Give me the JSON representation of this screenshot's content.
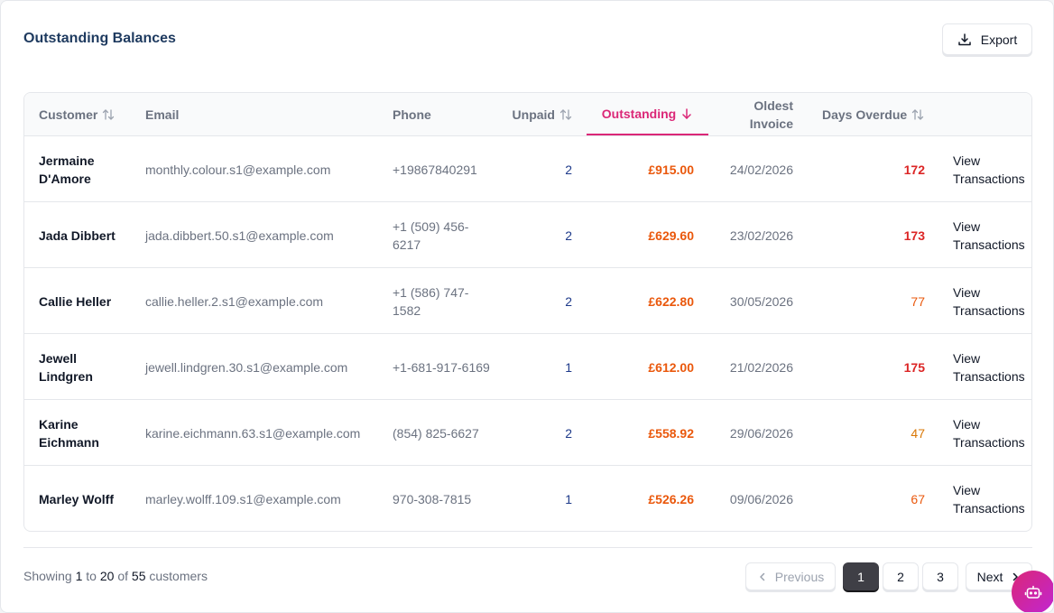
{
  "page": {
    "title": "Outstanding Balances",
    "export_label": "Export"
  },
  "columns": {
    "customer": "Customer",
    "email": "Email",
    "phone": "Phone",
    "unpaid": "Unpaid",
    "outstanding": "Outstanding",
    "oldest_line1": "Oldest",
    "oldest_line2": "Invoice",
    "days_overdue": "Days Overdue"
  },
  "rows": [
    {
      "customer": "Jermaine D'Amore",
      "email": "monthly.colour.s1@example.com",
      "phone": "+19867840291",
      "unpaid": "2",
      "outstanding": "£915.00",
      "oldest": "24/02/2026",
      "days": "172",
      "days_color": "#dc2626",
      "action": "View Transactions"
    },
    {
      "customer": "Jada Dibbert",
      "email": "jada.dibbert.50.s1@example.com",
      "phone": "+1 (509) 456-6217",
      "unpaid": "2",
      "outstanding": "£629.60",
      "oldest": "23/02/2026",
      "days": "173",
      "days_color": "#dc2626",
      "action": "View Transactions"
    },
    {
      "customer": "Callie Heller",
      "email": "callie.heller.2.s1@example.com",
      "phone": "+1 (586) 747-1582",
      "unpaid": "2",
      "outstanding": "£622.80",
      "oldest": "30/05/2026",
      "days": "77",
      "days_color": "#ea580c",
      "action": "View Transactions"
    },
    {
      "customer": "Jewell Lindgren",
      "email": "jewell.lindgren.30.s1@example.com",
      "phone": "+1-681-917-6169",
      "unpaid": "1",
      "outstanding": "£612.00",
      "oldest": "21/02/2026",
      "days": "175",
      "days_color": "#dc2626",
      "action": "View Transactions"
    },
    {
      "customer": "Karine Eichmann",
      "email": "karine.eichmann.63.s1@example.com",
      "phone": "(854) 825-6627",
      "unpaid": "2",
      "outstanding": "£558.92",
      "oldest": "29/06/2026",
      "days": "47",
      "days_color": "#d97706",
      "action": "View Transactions"
    },
    {
      "customer": "Marley Wolff",
      "email": "marley.wolff.109.s1@example.com",
      "phone": "970-308-7815",
      "unpaid": "1",
      "outstanding": "£526.26",
      "oldest": "09/06/2026",
      "days": "67",
      "days_color": "#ea580c",
      "action": "View Transactions"
    }
  ],
  "footer": {
    "showing_prefix": "Showing",
    "from": "1",
    "to_word": "to",
    "to": "20",
    "of_word": "of",
    "total": "55",
    "suffix": "customers",
    "previous": "Previous",
    "next": "Next",
    "pages": [
      "1",
      "2",
      "3"
    ],
    "current_page": "1"
  },
  "icons": {
    "export": "download-icon",
    "sort": "sort-arrows-icon",
    "sort_active": "arrow-down-icon",
    "prev": "chevron-left-icon",
    "next": "chevron-right-icon",
    "assistant": "robot-icon"
  },
  "colors": {
    "accent": "#db2777",
    "outstanding": "#ea580c",
    "unpaid": "#1e3a8a",
    "title": "#1e3a5f"
  }
}
